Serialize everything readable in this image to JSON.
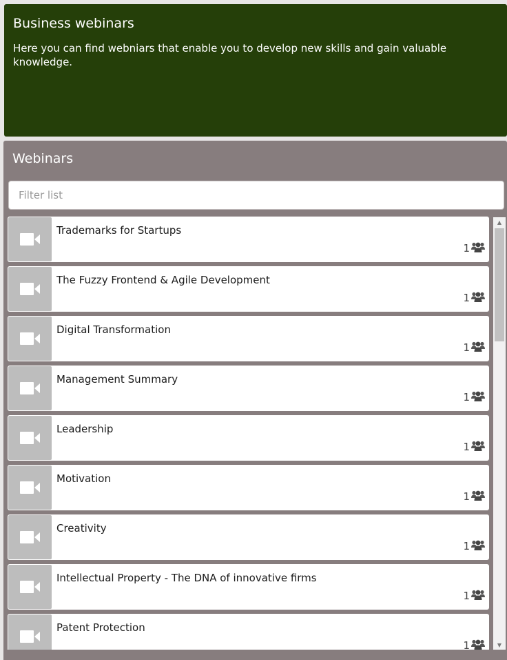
{
  "header": {
    "title": "Business webinars",
    "description": "Here you can find webniars that enable you to develop new skills and gain valuable knowledge."
  },
  "webinars": {
    "title": "Webinars",
    "filter_placeholder": "Filter list",
    "items": [
      {
        "title": "Trademarks for Startups",
        "count": "1",
        "icon": "video-camera-icon",
        "meta_icon": "users-icon"
      },
      {
        "title": "The Fuzzy Frontend & Agile Development",
        "count": "1",
        "icon": "video-camera-icon",
        "meta_icon": "users-icon"
      },
      {
        "title": "Digital Transformation",
        "count": "1",
        "icon": "video-camera-icon",
        "meta_icon": "users-icon"
      },
      {
        "title": "Management Summary",
        "count": "1",
        "icon": "video-camera-icon",
        "meta_icon": "users-icon"
      },
      {
        "title": "Leadership",
        "count": "1",
        "icon": "video-camera-icon",
        "meta_icon": "users-icon"
      },
      {
        "title": "Motivation",
        "count": "1",
        "icon": "video-camera-icon",
        "meta_icon": "users-icon"
      },
      {
        "title": "Creativity",
        "count": "1",
        "icon": "video-camera-icon",
        "meta_icon": "users-icon"
      },
      {
        "title": "Intellectual Property - The DNA of innovative firms",
        "count": "1",
        "icon": "video-camera-icon",
        "meta_icon": "users-icon"
      },
      {
        "title": "Patent Protection",
        "count": "1",
        "icon": "video-camera-icon",
        "meta_icon": "users-icon"
      }
    ]
  },
  "colors": {
    "header_bg": "#253f09",
    "panel_bg": "#877d7e",
    "thumb_bg": "#bdbdbd"
  }
}
